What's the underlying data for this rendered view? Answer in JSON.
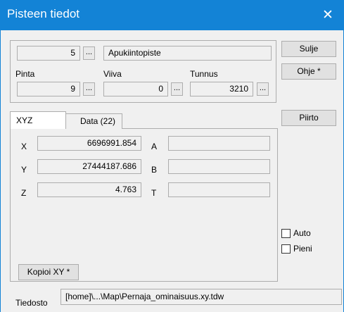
{
  "window": {
    "title": "Pisteen tiedot",
    "close_glyph": "✕"
  },
  "header": {
    "point_number": "5",
    "point_name": "Apukiintopiste",
    "dots_label": "..."
  },
  "fields": {
    "pinta": {
      "label": "Pinta",
      "value": "9"
    },
    "viiva": {
      "label": "Viiva",
      "value": "0"
    },
    "tunnus": {
      "label": "Tunnus",
      "value": "3210"
    }
  },
  "buttons": {
    "close": "Sulje",
    "help": "Ohje *",
    "draw": "Piirto",
    "copy_xy": "Kopioi XY *"
  },
  "tabs": [
    {
      "label": "XYZ",
      "active": true
    },
    {
      "label": "Data (22)",
      "active": false
    }
  ],
  "coords": {
    "x": {
      "label": "X",
      "value": "6696991.854"
    },
    "y": {
      "label": "Y",
      "value": "27444187.686"
    },
    "z": {
      "label": "Z",
      "value": "4.763"
    },
    "a": {
      "label": "A",
      "value": ""
    },
    "b": {
      "label": "B",
      "value": ""
    },
    "t": {
      "label": "T",
      "value": ""
    }
  },
  "checkboxes": {
    "auto": {
      "label": "Auto",
      "checked": false
    },
    "pieni": {
      "label": "Pieni",
      "checked": false
    }
  },
  "file": {
    "label": "Tiedosto",
    "path": "[home]\\...\\Map\\Pernaja_ominaisuus.xy.tdw"
  },
  "colors": {
    "titlebar": "#1383d6",
    "background": "#f0f0f0"
  },
  "icons": {
    "close": "close-icon",
    "dots": "ellipsis"
  }
}
